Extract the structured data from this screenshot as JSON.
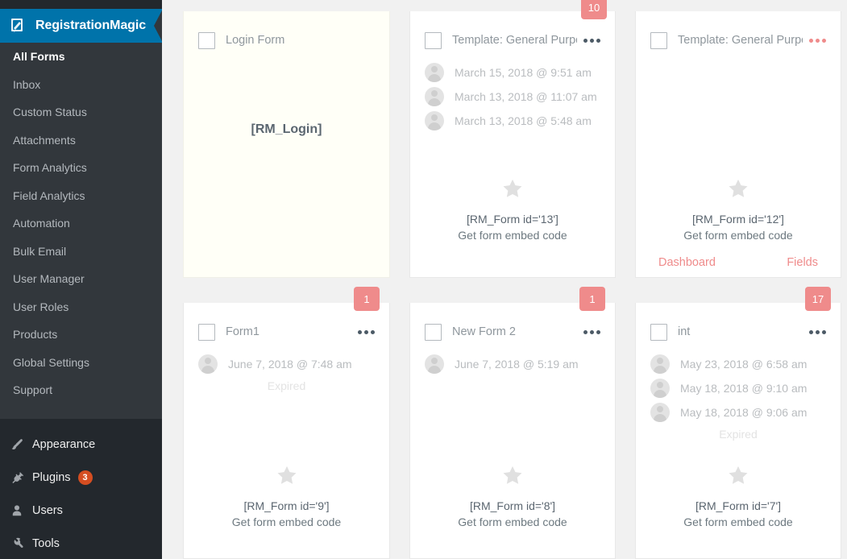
{
  "brand": {
    "label": "RegistrationMagic",
    "icon": "registrationmagic-logo-icon",
    "color": "#0073aa"
  },
  "sidebar": {
    "plugin_items": [
      {
        "label": "All Forms",
        "active": true
      },
      {
        "label": "Inbox",
        "active": false
      },
      {
        "label": "Custom Status",
        "active": false
      },
      {
        "label": "Attachments",
        "active": false
      },
      {
        "label": "Form Analytics",
        "active": false
      },
      {
        "label": "Field Analytics",
        "active": false
      },
      {
        "label": "Automation",
        "active": false
      },
      {
        "label": "Bulk Email",
        "active": false
      },
      {
        "label": "User Manager",
        "active": false
      },
      {
        "label": "User Roles",
        "active": false
      },
      {
        "label": "Products",
        "active": false
      },
      {
        "label": "Global Settings",
        "active": false
      },
      {
        "label": "Support",
        "active": false
      }
    ],
    "wp_items": [
      {
        "label": "Appearance",
        "icon": "paintbrush-icon",
        "badge": ""
      },
      {
        "label": "Plugins",
        "icon": "plug-icon",
        "badge": "3"
      },
      {
        "label": "Users",
        "icon": "user-icon",
        "badge": ""
      },
      {
        "label": "Tools",
        "icon": "wrench-icon",
        "badge": ""
      }
    ],
    "badge_color": "#d54e21"
  },
  "forms": [
    {
      "title": "Login Form",
      "checkbox_checked": false,
      "badge": "",
      "menu_color": "dark",
      "show_menu": false,
      "entries": [],
      "expired": false,
      "shortcode": "[RM_Login]",
      "embed_label": "",
      "star": false,
      "links": [],
      "cream": true
    },
    {
      "title": "Template: General Purpo...",
      "checkbox_checked": false,
      "badge": "10",
      "menu_color": "dark",
      "show_menu": true,
      "entries": [
        "March 15, 2018 @ 9:51 am",
        "March 13, 2018 @ 11:07 am",
        "March 13, 2018 @ 5:48 am"
      ],
      "expired": false,
      "shortcode": "[RM_Form id='13']",
      "embed_label": "Get form embed code",
      "star": true,
      "links": [],
      "cream": false
    },
    {
      "title": "Template: General Purpo...",
      "checkbox_checked": false,
      "badge": "",
      "menu_color": "red",
      "show_menu": true,
      "entries": [],
      "expired": false,
      "shortcode": "[RM_Form id='12']",
      "embed_label": "Get form embed code",
      "star": true,
      "links": [
        "Dashboard",
        "Fields"
      ],
      "cream": false
    },
    {
      "title": "Form1",
      "checkbox_checked": false,
      "badge": "1",
      "menu_color": "dark",
      "show_menu": true,
      "entries": [
        "June 7, 2018 @ 7:48 am"
      ],
      "expired": true,
      "expired_label": "Expired",
      "shortcode": "[RM_Form id='9']",
      "embed_label": "Get form embed code",
      "star": true,
      "links": [],
      "cream": false
    },
    {
      "title": "New Form 2",
      "checkbox_checked": false,
      "badge": "1",
      "menu_color": "dark",
      "show_menu": true,
      "entries": [
        "June 7, 2018 @ 5:19 am"
      ],
      "expired": false,
      "shortcode": "[RM_Form id='8']",
      "embed_label": "Get form embed code",
      "star": true,
      "links": [],
      "cream": false
    },
    {
      "title": "int",
      "checkbox_checked": false,
      "badge": "17",
      "menu_color": "dark",
      "show_menu": true,
      "entries": [
        "May 23, 2018 @ 6:58 am",
        "May 18, 2018 @ 9:10 am",
        "May 18, 2018 @ 9:06 am"
      ],
      "expired": true,
      "expired_label": "Expired",
      "shortcode": "[RM_Form id='7']",
      "embed_label": "Get form embed code",
      "star": true,
      "links": [],
      "cream": false
    }
  ],
  "colors": {
    "sidebar_bg": "#32373c",
    "sidebar_dark": "#23282d",
    "accent_pink": "#ef8b8b",
    "page_bg": "#f1f1f1"
  }
}
